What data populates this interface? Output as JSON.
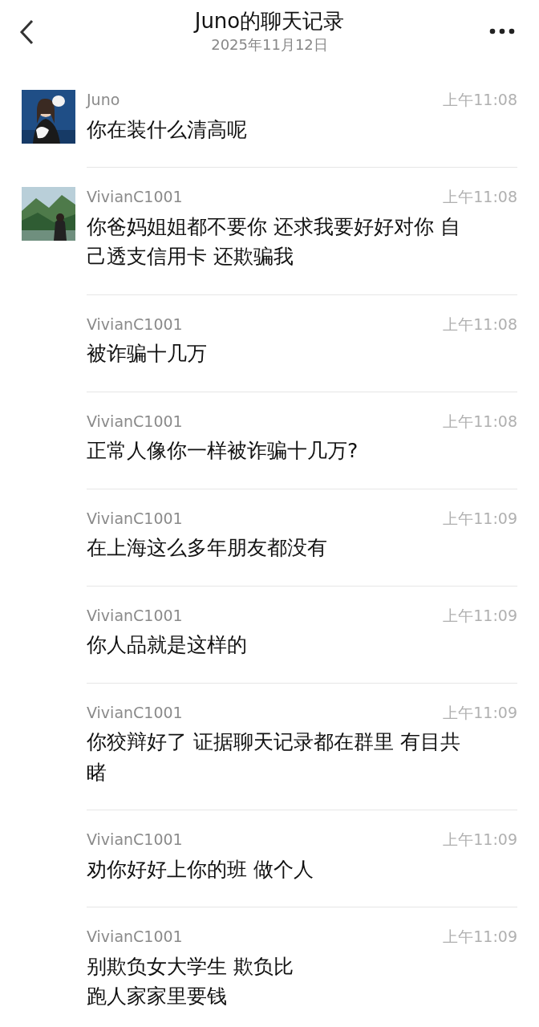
{
  "header": {
    "title": "Juno的聊天记录",
    "date": "2025年11月12日"
  },
  "messages": [
    {
      "sender": "Juno",
      "time": "上午11:08",
      "lines": [
        "你在装什么清高呢"
      ],
      "avatar": {
        "kind": "picture"
      }
    },
    {
      "sender": "VivianC1001",
      "time": "上午11:08",
      "lines": [
        "你爸妈姐姐都不要你 还求我要好好对你 自",
        "己透支信用卡 还欺骗我"
      ],
      "avatar": {
        "kind": "picture"
      }
    },
    {
      "sender": "VivianC1001",
      "time": "上午11:08",
      "lines": [
        "被诈骗十几万"
      ]
    },
    {
      "sender": "VivianC1001",
      "time": "上午11:08",
      "lines": [
        "正常人像你一样被诈骗十几万?"
      ]
    },
    {
      "sender": "VivianC1001",
      "time": "上午11:09",
      "lines": [
        "在上海这么多年朋友都没有"
      ]
    },
    {
      "sender": "VivianC1001",
      "time": "上午11:09",
      "lines": [
        "你人品就是这样的"
      ]
    },
    {
      "sender": "VivianC1001",
      "time": "上午11:09",
      "lines": [
        "你狡辩好了 证据聊天记录都在群里 有目共",
        "睹"
      ]
    },
    {
      "sender": "VivianC1001",
      "time": "上午11:09",
      "lines": [
        "劝你好好上你的班 做个人"
      ]
    },
    {
      "sender": "VivianC1001",
      "time": "上午11:09",
      "lines": [
        "别欺负女大学生 欺负比",
        "跑人家家里要钱"
      ]
    }
  ]
}
